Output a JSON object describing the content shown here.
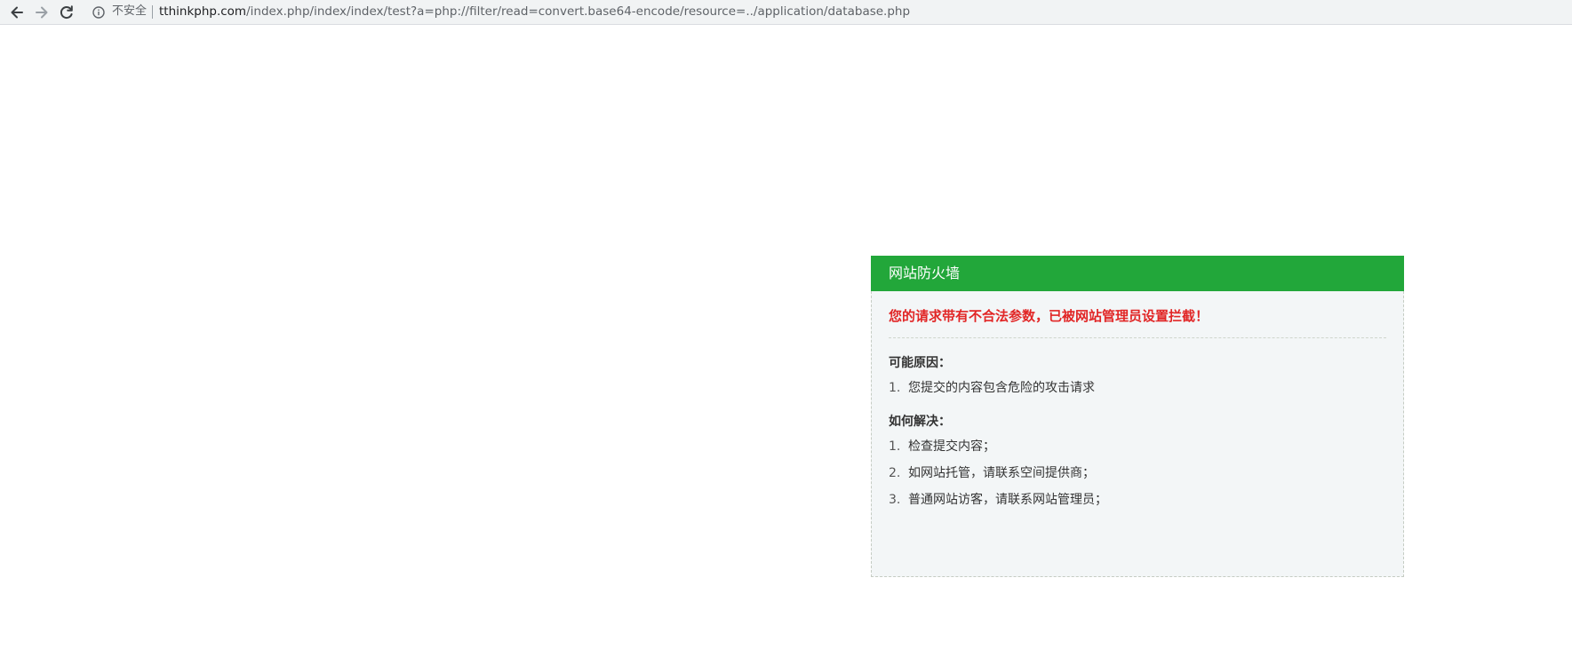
{
  "browser": {
    "back_icon": "back-arrow-icon",
    "forward_icon": "forward-arrow-icon",
    "reload_icon": "reload-icon",
    "security_icon": "info-icon",
    "security_label": "不安全",
    "url_host": "tthinkphp.com",
    "url_path": "/index.php/index/index/test?a=php://filter/read=convert.base64-encode/resource=../application/database.php"
  },
  "firewall": {
    "title": "网站防火墙",
    "warning": "您的请求带有不合法参数，已被网站管理员设置拦截！",
    "reasons_title": "可能原因：",
    "reasons": [
      {
        "num": "1.",
        "text": "您提交的内容包含危险的攻击请求"
      }
    ],
    "solutions_title": "如何解决：",
    "solutions": [
      {
        "num": "1.",
        "text": "检查提交内容；"
      },
      {
        "num": "2.",
        "text": "如网站托管，请联系空间提供商；"
      },
      {
        "num": "3.",
        "text": "普通网站访客，请联系网站管理员；"
      }
    ]
  },
  "colors": {
    "header_green": "#22a73a",
    "warning_red": "#e12626",
    "panel_bg": "#f3f6f7"
  }
}
